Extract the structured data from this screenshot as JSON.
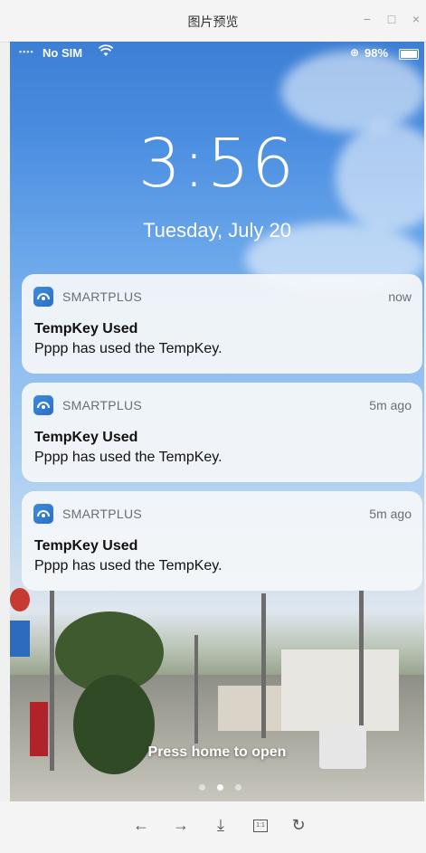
{
  "window": {
    "title": "图片预览",
    "controls": {
      "minimize": "−",
      "maximize": "□",
      "close": "×"
    }
  },
  "status_bar": {
    "carrier": "No SIM",
    "wifi_icon": "wifi-icon",
    "battery_pct": "98%",
    "battery_level": 0.98
  },
  "lockscreen": {
    "time": "3:56",
    "date": "Tuesday, July 20",
    "hint": "Press home to open",
    "page_count": 3,
    "current_page": 1
  },
  "notifications": [
    {
      "app": "SMARTPLUS",
      "time": "now",
      "title": "TempKey Used",
      "body": "Pppp has used the TempKey."
    },
    {
      "app": "SMARTPLUS",
      "time": "5m ago",
      "title": "TempKey Used",
      "body": "Pppp has used the TempKey."
    },
    {
      "app": "SMARTPLUS",
      "time": "5m ago",
      "title": "TempKey Used",
      "body": "Pppp has used the TempKey."
    }
  ],
  "toolbar": {
    "prev": "←",
    "next": "→",
    "download": "⤓",
    "actual_size": "1:1",
    "rotate": "↻"
  },
  "colors": {
    "notification_bg": "#f4f6f9",
    "app_icon": "#2f78cf",
    "sky_top": "#3d7fd4"
  }
}
